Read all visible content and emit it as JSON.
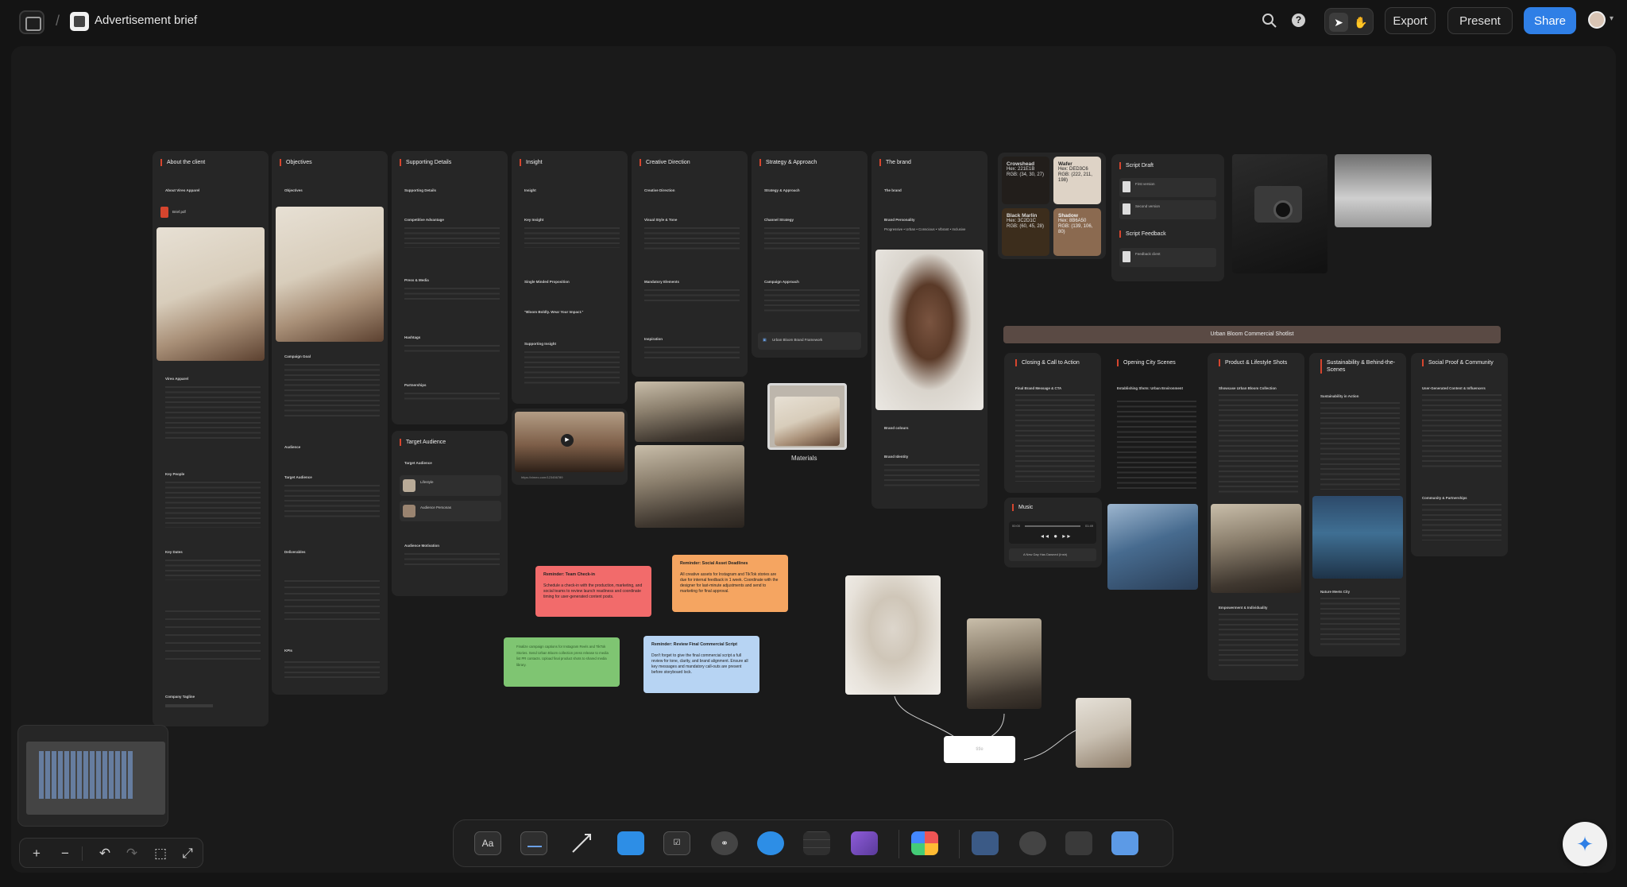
{
  "topbar": {
    "breadcrumb_sep": "/",
    "doc_title": "Advertisement brief",
    "export_label": "Export",
    "present_label": "Present",
    "share_label": "Share",
    "help_glyph": "?"
  },
  "cards": [
    {
      "title": "About the client",
      "subs": [
        "About Vireo Apparel",
        "Vireo Apparel",
        "Key People",
        "Key Dates",
        "Company Tagline"
      ],
      "file": "Brief.pdf"
    },
    {
      "title": "Objectives",
      "subs": [
        "Objectives",
        "Campaign Goal",
        "Audience",
        "Target Audience",
        "Deliverables",
        "KPIs"
      ]
    },
    {
      "title": "Supporting Details",
      "subs": [
        "Supporting Details",
        "Competitive Advantage",
        "Press & Media",
        "Hashtags",
        "Partnerships"
      ]
    },
    {
      "title": "Insight",
      "subs": [
        "Insight",
        "Key Insight",
        "Single Minded Proposition",
        "\"Bloom Boldly. Wear Your Impact.\"",
        "Supporting Insight"
      ]
    },
    {
      "title": "Creative Direction",
      "subs": [
        "Creative Direction",
        "Visual Style & Tone",
        "Mandatory Elements",
        "Inspiration"
      ]
    },
    {
      "title": "Strategy & Approach",
      "subs": [
        "Strategy & Approach",
        "Channel Strategy",
        "Campaign Approach"
      ],
      "file": "Urban Bloom Brand Framework"
    },
    {
      "title": "The brand",
      "subs": [
        "The brand",
        "Brand Personality",
        "Brand colours",
        "Brand Identity"
      ],
      "personality": "Progressive • Urban • Conscious • Vibrant • Inclusive"
    },
    {
      "title": "Target Audience",
      "subs": [
        "Target Audience",
        "Audience Motivation"
      ],
      "items": [
        "Lifestyle",
        "Audience Personas"
      ]
    }
  ],
  "swatches": [
    {
      "name": "Crowshead",
      "hex": "Hex: 221E1B",
      "rgb": "RGB: (34, 30, 27)",
      "color": "#221e1b",
      "text": "#ddd"
    },
    {
      "name": "Wafer",
      "hex": "Hex: DED3C6",
      "rgb": "RGB: (222, 211, 198)",
      "color": "#ded3c6",
      "text": "#222"
    },
    {
      "name": "Black Marlin",
      "hex": "Hex: 3C2D1C",
      "rgb": "RGB: (60, 45, 28)",
      "color": "#3c2d1c",
      "text": "#ddd"
    },
    {
      "name": "Shadow",
      "hex": "Hex: 8B6A50",
      "rgb": "RGB: (139, 106, 80)",
      "color": "#8b6a50",
      "text": "#f2f2f2"
    }
  ],
  "script": {
    "draft_title": "Script Draft",
    "feedback_title": "Script Feedback",
    "files": [
      "First version",
      "Second version",
      "Feedback client"
    ]
  },
  "materials_label": "Materials",
  "video_url": "https://vimeo.com/123456789",
  "shotlist": {
    "banner": "Urban Bloom Commercial Shotlist",
    "columns": [
      {
        "title": "Closing & Call to Action",
        "sub": "Final Brand Message & CTA"
      },
      {
        "title": "Opening City Scenes",
        "sub": "Establishing Shots: Urban Environment"
      },
      {
        "title": "Product & Lifestyle Shots",
        "sub": "Showcase Urban Bloom Collection",
        "sub2": "Empowerment & Individuality"
      },
      {
        "title": "Sustainability & Behind-the-Scenes",
        "sub": "Sustainability in Action",
        "sub2": "Nature Meets City"
      },
      {
        "title": "Social Proof & Community",
        "sub": "User-Generated Content & Influencers",
        "sub2": "Community & Partnerships"
      }
    ]
  },
  "music": {
    "title": "Music",
    "start": "00:00",
    "end": "01:49",
    "track": "A New Day Has Dawned (Instr)"
  },
  "stickies": [
    {
      "title": "Reminder: Team Check-in",
      "body": "Schedule a check-in with the production, marketing, and social teams to review launch readiness and coordinate timing for user-generated content posts.",
      "color": "#f26b6b"
    },
    {
      "title": "Reminder: Social Asset Deadlines",
      "body": "All creative assets for Instagram and TikTok stories are due for internal feedback in 1 week. Coordinate with the designer for last-minute adjustments and send to marketing for final approval.",
      "color": "#f5a561"
    },
    {
      "title": "Reminder: Review Final Commercial Script",
      "body": "Don't forget to give the final commercial script a full review for tone, clarity, and brand alignment. Ensure all key messages and mandatory call-outs are present before storyboard lock.",
      "color": "#b7d4f3"
    },
    {
      "title": "",
      "body": "Finalize campaign captions for Instagram Reels and TikTok Stories. Send Urban Bloom collection press release to media list PR contacts. Upload final product shots to shared media library.",
      "color": "#7fc572"
    }
  ],
  "node_label": "title",
  "colors": {
    "accent": "#2f7fe6",
    "card_marker": "#d6452e",
    "canvas": "#1a1a1a"
  },
  "dock_icons": [
    "text-icon",
    "note-icon",
    "arrow-icon",
    "folder-icon",
    "checklist-icon",
    "link-icon",
    "comment-icon",
    "table-icon",
    "image-icon",
    "apps-icon",
    "board-icon",
    "sketch-icon",
    "file-icon",
    "upload-icon"
  ],
  "zoom_glyphs": {
    "plus": "+",
    "minus": "−",
    "undo": "↶",
    "redo": "↷",
    "fit": "⬚",
    "expand": "⤢"
  },
  "text_style_label": "Aa"
}
